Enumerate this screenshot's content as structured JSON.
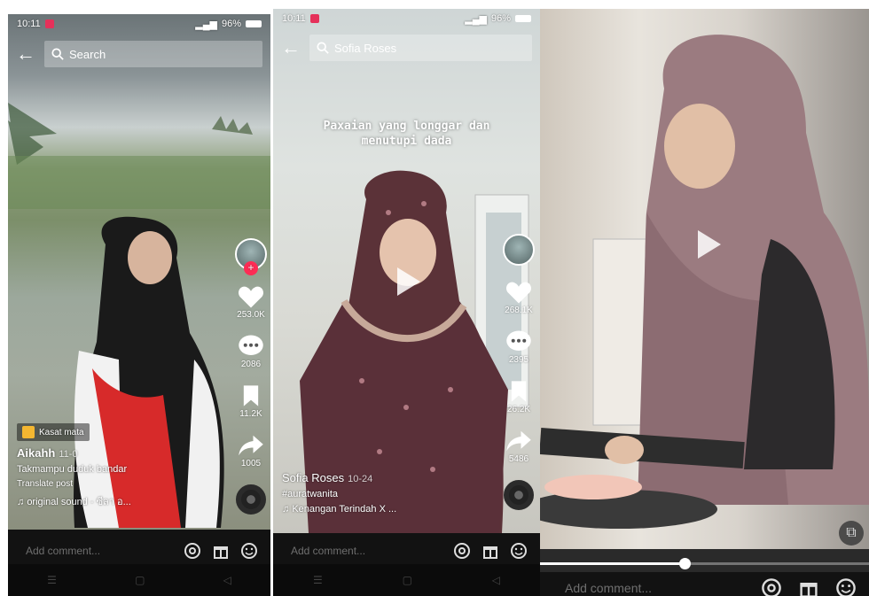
{
  "panels": [
    {
      "status": {
        "time": "10:11",
        "battery": "96%"
      },
      "search": {
        "text": "Search"
      },
      "actions": {
        "likes": "253.0K",
        "comments": "2086",
        "saves": "11.2K",
        "shares": "1005"
      },
      "badge": "Kasat mata",
      "username": "Aikahh",
      "date": "11-0",
      "description": "Takmampu duduk bandar",
      "translate": "Translate post",
      "sound": "original sound - ซีลา อ...",
      "comment_placeholder": "Add comment..."
    },
    {
      "status": {
        "time": "10:11",
        "battery": "96%"
      },
      "search": {
        "text": "Sofia Roses"
      },
      "overlay_line1": "Paxaian yang longgar dan",
      "overlay_line2": "menutupi dada",
      "actions": {
        "likes": "268.1K",
        "comments": "2395",
        "saves": "26.2K",
        "shares": "5486"
      },
      "username": "Sofia Roses",
      "date": "10-24",
      "hashtag": "#auratwanita",
      "sound": "Kenangan Terindah X ...",
      "comment_placeholder": "Add comment..."
    },
    {
      "progress": 0.44,
      "comment_placeholder": "Add comment..."
    }
  ],
  "colors": {
    "accent": "#fe2c55",
    "badge": "#f4b731"
  },
  "icons": [
    "back-arrow-icon",
    "search-icon",
    "heart-icon",
    "comment-icon",
    "bookmark-icon",
    "share-icon",
    "at-icon",
    "gift-icon",
    "emoji-icon",
    "play-icon",
    "music-note-icon",
    "pip-icon"
  ]
}
